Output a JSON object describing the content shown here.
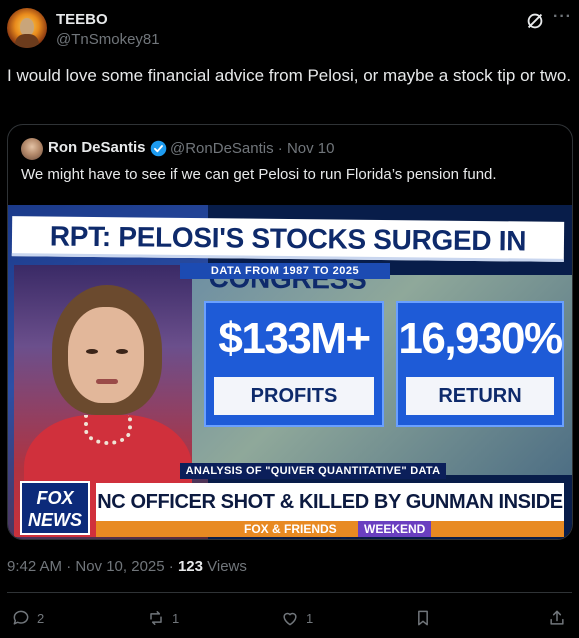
{
  "author": {
    "name": "TEEBO",
    "handle": "@TnSmokey81"
  },
  "post": {
    "text": "I would love some financial advice from Pelosi, or maybe a stock tip or two."
  },
  "quote": {
    "name": "Ron DeSantis",
    "handle_date": "@RonDeSantis · Nov 10",
    "text": "We might have to see if we can get Pelosi to run Florida’s pension fund."
  },
  "image": {
    "headline": "RPT: PELOSI'S STOCKS SURGED IN CONGRESS",
    "subhead": "DATA FROM 1987 TO 2025",
    "stat1_value": "$133M+",
    "stat1_label": "PROFITS",
    "stat2_value": "16,930%",
    "stat2_label": "RETURN",
    "analysis": "ANALYSIS OF \"QUIVER QUANTITATIVE\" DATA",
    "logo_line1": "FOX",
    "logo_line2": "NEWS",
    "ticker": "NC OFFICER SHOT & KILLED BY GUNMAN INSIDE HOSPITAL",
    "show": "FOX & FRIENDS",
    "show_tag": "WEEKEND"
  },
  "meta": {
    "time_date": "9:42 AM · Nov 10, 2025 · ",
    "views_count": "123",
    "views_label": " Views"
  },
  "actions": {
    "replies": "2",
    "reposts": "1",
    "likes": "1"
  },
  "colors": {
    "background": "#000000",
    "text": "#e7e9ea",
    "muted": "#71767b",
    "verified": "#1d9bf0"
  }
}
